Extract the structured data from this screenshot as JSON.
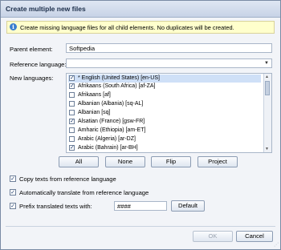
{
  "window": {
    "title": "Create multiple new files"
  },
  "info": {
    "text": "Create missing language files for all child elements. No duplicates will be created."
  },
  "parent": {
    "label": "Parent element:",
    "value": "Softpedia"
  },
  "reference": {
    "label": "Reference language:",
    "value": ""
  },
  "languages": {
    "label": "New languages:",
    "items": [
      {
        "label": "* English (United States) [en-US]",
        "checked": true,
        "selected": true
      },
      {
        "label": "Afrikaans (South Africa) [af-ZA]",
        "checked": true,
        "selected": false
      },
      {
        "label": "Afrikaans [af]",
        "checked": false,
        "selected": false
      },
      {
        "label": "Albanian (Albania) [sq-AL]",
        "checked": false,
        "selected": false
      },
      {
        "label": "Albanian [sq]",
        "checked": false,
        "selected": false
      },
      {
        "label": "Alsatian (France) [gsw-FR]",
        "checked": true,
        "selected": false
      },
      {
        "label": "Amharic (Ethiopia) [am-ET]",
        "checked": false,
        "selected": false
      },
      {
        "label": "Arabic (Algeria) [ar-DZ]",
        "checked": false,
        "selected": false
      },
      {
        "label": "Arabic (Bahrain) [ar-BH]",
        "checked": true,
        "selected": false
      }
    ]
  },
  "buttons": {
    "all": "All",
    "none": "None",
    "flip": "Flip",
    "project": "Project"
  },
  "options": {
    "copy": {
      "label": "Copy texts from reference language",
      "checked": true
    },
    "translate": {
      "label": "Automatically translate from reference language",
      "checked": true
    },
    "prefix": {
      "label": "Prefix translated texts with:",
      "checked": true,
      "value": "####"
    },
    "default_label": "Default"
  },
  "footer": {
    "ok": "OK",
    "cancel": "Cancel"
  },
  "icons": {
    "info": "info-icon",
    "dropdown": "chevron-down-icon",
    "check": "check-icon"
  }
}
